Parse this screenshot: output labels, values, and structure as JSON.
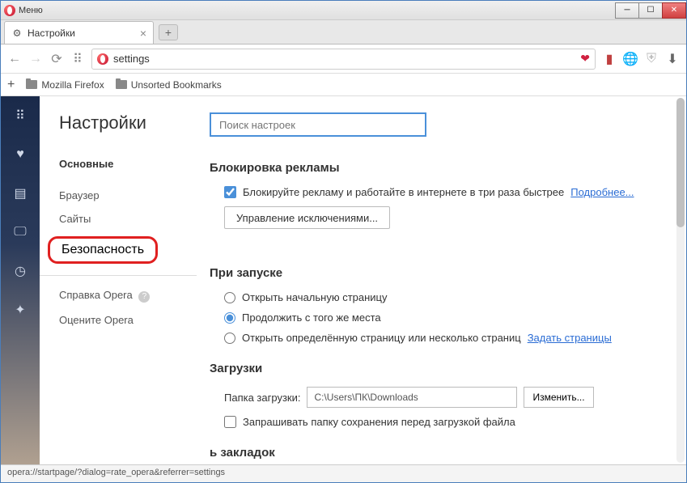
{
  "titlebar": {
    "menu_label": "Меню"
  },
  "tabs": [
    {
      "label": "Настройки"
    }
  ],
  "address_bar": {
    "url": "settings"
  },
  "bookmarks": [
    {
      "label": "Mozilla Firefox"
    },
    {
      "label": "Unsorted Bookmarks"
    }
  ],
  "sidebar": {
    "title": "Настройки",
    "main_section": "Основные",
    "items": [
      {
        "label": "Браузер"
      },
      {
        "label": "Сайты"
      },
      {
        "label": "Безопасность"
      }
    ],
    "footer": [
      {
        "label": "Справка Opera"
      },
      {
        "label": "Оцените Opera"
      }
    ]
  },
  "content": {
    "search_placeholder": "Поиск настроек",
    "adblock": {
      "title": "Блокировка рекламы",
      "checkbox_label": "Блокируйте рекламу и работайте в интернете в три раза быстрее",
      "more_link": "Подробнее...",
      "manage_button": "Управление исключениями..."
    },
    "startup": {
      "title": "При запуске",
      "options": [
        "Открыть начальную страницу",
        "Продолжить с того же места",
        "Открыть определённую страницу или несколько страниц"
      ],
      "set_pages_link": "Задать страницы"
    },
    "downloads": {
      "title": "Загрузки",
      "folder_label": "Папка загрузки:",
      "folder_path": "C:\\Users\\ПК\\Downloads",
      "change_button": "Изменить...",
      "ask_checkbox": "Запрашивать папку сохранения перед загрузкой файла"
    },
    "bookmarks_panel": {
      "title": "ь закладок"
    }
  },
  "status": {
    "text": "opera://startpage/?dialog=rate_opera&referrer=settings"
  }
}
